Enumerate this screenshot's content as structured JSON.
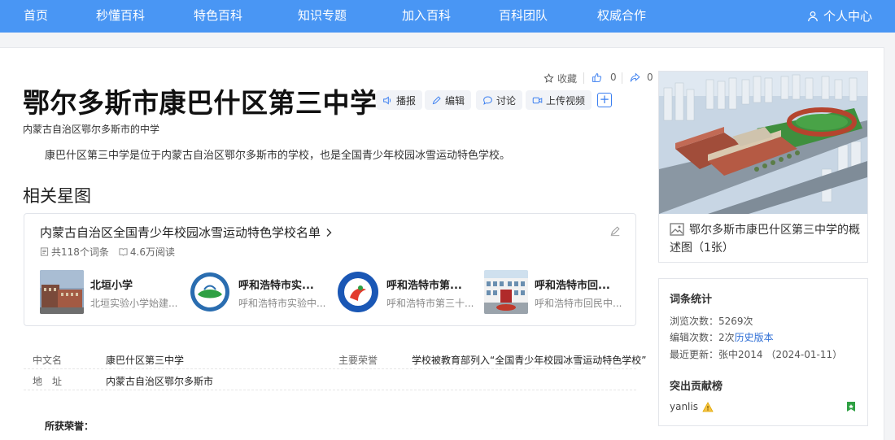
{
  "nav": {
    "items": [
      "首页",
      "秒懂百科",
      "特色百科",
      "知识专题",
      "加入百科",
      "百科团队",
      "权威合作"
    ],
    "user_center": "个人中心"
  },
  "actions": {
    "collect": "收藏",
    "like_count": "0",
    "share_count": "0"
  },
  "title": "鄂尔多斯市康巴什区第三中学",
  "toolbar": {
    "broadcast": "播报",
    "edit": "编辑",
    "discuss": "讨论",
    "upload_video": "上传视频",
    "plus": "+"
  },
  "subtitle": "内蒙古自治区鄂尔多斯市的中学",
  "summary": "康巴什区第三中学是位于内蒙古自治区鄂尔多斯市的学校，也是全国青少年校园冰雪运动特色学校。",
  "related": {
    "heading": "相关星图",
    "list_title": "内蒙古自治区全国青少年校园冰雪运动特色学校名单",
    "entries": "共118个词条",
    "reads": "4.6万阅读",
    "items": [
      {
        "name": "北垣小学",
        "desc": "北垣实验小学始建..."
      },
      {
        "name": "呼和浩特市实...",
        "desc": "呼和浩特市实验中..."
      },
      {
        "name": "呼和浩特市第...",
        "desc": "呼和浩特市第三十..."
      },
      {
        "name": "呼和浩特市回...",
        "desc": "呼和浩特市回民中..."
      }
    ]
  },
  "infobox": {
    "rows": [
      {
        "k1": "中文名",
        "v1": "康巴什区第三中学",
        "k2": "主要荣誉",
        "v2": "学校被教育部列入“全国青少年校园冰雪运动特色学校”"
      },
      {
        "k1": "地　址",
        "v1": "内蒙古自治区鄂尔多斯市",
        "k2": "",
        "v2": ""
      }
    ]
  },
  "honors_label": "所获荣誉：",
  "image_caption": "鄂尔多斯市康巴什区第三中学的概述图（1张）",
  "stats": {
    "heading": "词条统计",
    "views": "浏览次数：5269次",
    "edits_prefix": "编辑次数：2次",
    "history": "历史版本",
    "updated": "最近更新：张中2014 （2024-01-11）",
    "contrib_heading": "突出贡献榜",
    "contributor": "yanlis"
  },
  "colors": {
    "nav_bg": "#4996f4",
    "link": "#2f6fd6",
    "accent": "#3b7ff0"
  }
}
